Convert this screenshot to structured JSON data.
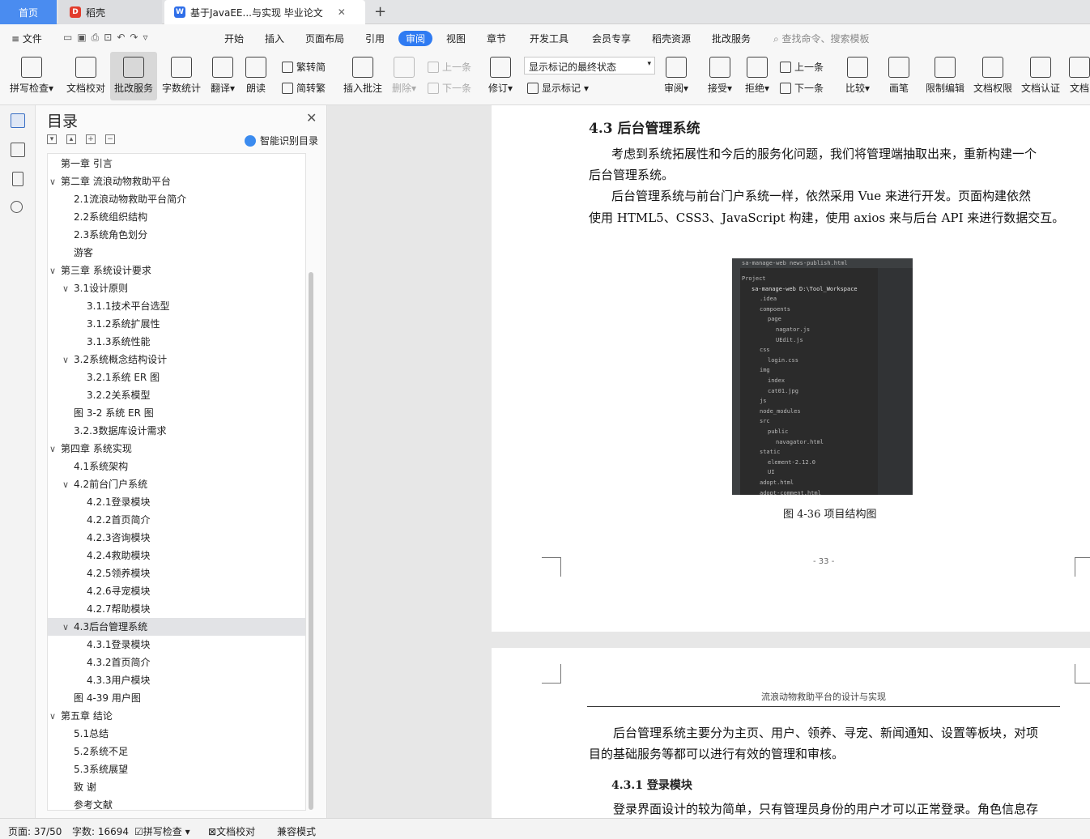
{
  "tabs": {
    "home": "首页",
    "daoke": "稻壳",
    "doc": "基于JavaEE...与实现 毕业论文"
  },
  "menu": [
    "文件",
    "开始",
    "插入",
    "页面布局",
    "引用",
    "审阅",
    "视图",
    "章节",
    "开发工具",
    "会员专享",
    "稻壳资源",
    "批改服务"
  ],
  "search_placeholder": "查找命令、搜索模板",
  "ribbon": {
    "spell": "拼写检查",
    "proof": "文档校对",
    "correct": "批改服务",
    "count": "字数统计",
    "translate": "翻译",
    "read": "朗读",
    "trad": "繁转简",
    "simp": "简转繁",
    "insert_comment": "插入批注",
    "delete": "删除",
    "prev": "上一条",
    "next": "下一条",
    "revise": "修订",
    "status_value": "显示标记的最终状态",
    "show_marks": "显示标记",
    "review": "审阅",
    "accept": "接受",
    "reject": "拒绝",
    "prev2": "上一条",
    "next2": "下一条",
    "compare": "比较",
    "pen": "画笔",
    "restrict": "限制编辑",
    "rights": "文档权限",
    "cert": "文档认证",
    "more": "文档"
  },
  "toc": {
    "title": "目录",
    "smart": "智能识别目录",
    "items": [
      {
        "label": "第一章 引言",
        "level": 0,
        "caret": ""
      },
      {
        "label": "第二章 流浪动物救助平台",
        "level": 0,
        "caret": "v"
      },
      {
        "label": "2.1流浪动物救助平台简介",
        "level": 1,
        "caret": ""
      },
      {
        "label": "2.2系统组织结构",
        "level": 1,
        "caret": ""
      },
      {
        "label": "2.3系统角色划分",
        "level": 1,
        "caret": ""
      },
      {
        "label": "游客",
        "level": 1,
        "caret": ""
      },
      {
        "label": "第三章 系统设计要求",
        "level": 0,
        "caret": "v"
      },
      {
        "label": "3.1设计原则",
        "level": 1,
        "caret": "v"
      },
      {
        "label": "3.1.1技术平台选型",
        "level": 2,
        "caret": ""
      },
      {
        "label": "3.1.2系统扩展性",
        "level": 2,
        "caret": ""
      },
      {
        "label": "3.1.3系统性能",
        "level": 2,
        "caret": ""
      },
      {
        "label": "3.2系统概念结构设计",
        "level": 1,
        "caret": "v"
      },
      {
        "label": "3.2.1系统 ER 图",
        "level": 2,
        "caret": ""
      },
      {
        "label": "3.2.2关系模型",
        "level": 2,
        "caret": ""
      },
      {
        "label": "图 3-2 系统 ER 图",
        "level": 1,
        "caret": ""
      },
      {
        "label": "3.2.3数据库设计需求",
        "level": 1,
        "caret": ""
      },
      {
        "label": "第四章 系统实现",
        "level": 0,
        "caret": "v"
      },
      {
        "label": "4.1系统架构",
        "level": 1,
        "caret": ""
      },
      {
        "label": "4.2前台门户系统",
        "level": 1,
        "caret": "v"
      },
      {
        "label": "4.2.1登录模块",
        "level": 2,
        "caret": ""
      },
      {
        "label": "4.2.2首页简介",
        "level": 2,
        "caret": ""
      },
      {
        "label": "4.2.3咨询模块",
        "level": 2,
        "caret": ""
      },
      {
        "label": "4.2.4救助模块",
        "level": 2,
        "caret": ""
      },
      {
        "label": "4.2.5领养模块",
        "level": 2,
        "caret": ""
      },
      {
        "label": "4.2.6寻宠模块",
        "level": 2,
        "caret": ""
      },
      {
        "label": "4.2.7帮助模块",
        "level": 2,
        "caret": ""
      },
      {
        "label": "4.3后台管理系统",
        "level": 1,
        "caret": "v",
        "selected": true
      },
      {
        "label": "4.3.1登录模块",
        "level": 2,
        "caret": ""
      },
      {
        "label": "4.3.2首页简介",
        "level": 2,
        "caret": ""
      },
      {
        "label": "4.3.3用户模块",
        "level": 2,
        "caret": ""
      },
      {
        "label": "图 4-39 用户图",
        "level": 1,
        "caret": ""
      },
      {
        "label": "第五章 结论",
        "level": 0,
        "caret": "v"
      },
      {
        "label": "5.1总结",
        "level": 1,
        "caret": ""
      },
      {
        "label": "5.2系统不足",
        "level": 1,
        "caret": ""
      },
      {
        "label": "5.3系统展望",
        "level": 1,
        "caret": ""
      },
      {
        "label": "致 谢",
        "level": 1,
        "caret": ""
      },
      {
        "label": "参考文献",
        "level": 1,
        "caret": ""
      }
    ]
  },
  "page1": {
    "heading": "4.3 后台管理系统",
    "p1a": "考虑到系统拓展性和今后的服务化问题，我们将管理端抽取出来，重新构建一个",
    "p1b": "后台管理系统。",
    "p2a": "后台管理系统与前台门户系统一样，依然采用 Vue 来进行开发。页面构建依然",
    "p2b": "使用 HTML5、CSS3、JavaScript 构建，使用 axios 来与后台 API 来进行数据交互。",
    "caption": "图 4-36 项目结构图",
    "page_number": "- 33 -",
    "figure_lines": [
      "sa-manage-web  news-publish.html",
      "Project",
      "sa-manage-web  D:\\Tool_Workspace",
      ".idea",
      "compoents",
      "page",
      "nagator.js",
      "UEdit.js",
      "css",
      "login.css",
      "img",
      "index",
      "cat01.jpg",
      "js",
      "node_modules",
      "src",
      "public",
      "navagator.html",
      "static",
      "element-2.12.0",
      "UI",
      "adopt.html",
      "adopt-comment.html"
    ]
  },
  "page2": {
    "header": "流浪动物救助平台的设计与实现",
    "p1a": "后台管理系统主要分为主页、用户、领养、寻宠、新闻通知、设置等板块，对项",
    "p1b": "目的基础服务等都可以进行有效的管理和审核。",
    "sub": "4.3.1 登录模块",
    "p2a": "登录界面设计的较为简单，只有管理员身份的用户才可以正常登录。角色信息存"
  },
  "status": {
    "page": "页面: 37/50",
    "words": "字数: 16694",
    "spell": "拼写检查",
    "proof": "文档校对",
    "compat": "兼容模式"
  }
}
